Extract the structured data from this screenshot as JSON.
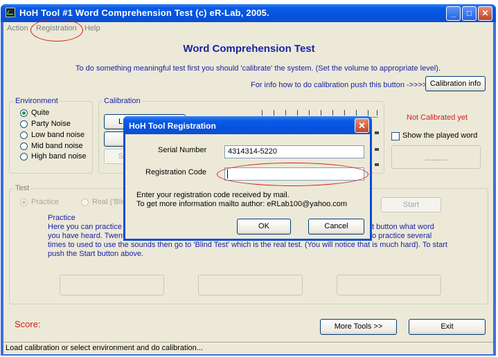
{
  "window": {
    "title": "HoH Tool #1 Word Comprehension Test  (c) eR-Lab, 2005.",
    "minimize": "_",
    "maximize": "□",
    "close": "✕"
  },
  "menu": [
    "Action",
    "Registration",
    "Help"
  ],
  "heading": "Word Comprehension Test",
  "intro": "To do something meaningful test first you should 'calibrate' the system. (Set the volume to appropriate level).",
  "calibration_hint": "For info how to do calibration push this button ->>>>",
  "calibration_info_button": "Calibration info",
  "environment": {
    "label": "Environment",
    "options": [
      "Quite",
      "Party Noise",
      "Low band noise",
      "Mid band noise",
      "High band noise"
    ],
    "selected": 0
  },
  "calibration": {
    "label": "Calibration",
    "button1": "L",
    "button3": "S",
    "status": "Not Calibrated yet",
    "show_word_label": "Show the played word",
    "word_placeholder": ".........."
  },
  "test": {
    "label": "Test",
    "practice_option": "Practice",
    "real_option": "Real ('Blin",
    "start_button": "Start",
    "desc_title": "Practice",
    "desc_line1_left": "Here you can practice",
    "desc_line1_right": "t button what word",
    "desc_line2_left": "you have heard. Twent",
    "desc_line2_right": "o practice several",
    "desc_line3": "times to used to use the sounds then go to 'Blind Test' which is the real test. (You will notice that is much hard).  To start",
    "desc_line4": "push the Start button above."
  },
  "score_label": "Score:",
  "more_tools_button": "More Tools >>",
  "exit_button": "Exit",
  "status_bar": "Load calibration or select environment and do calibration...",
  "dialog": {
    "title": "HoH Tool Registration",
    "close": "✕",
    "serial_label": "Serial Number",
    "serial_value": "4314314-5220",
    "code_label": "Registration Code",
    "code_value": "",
    "info_line1": "Enter your registration code received by mail.",
    "info_line2": "To get more information mailto author: eRLab100@yahoo.com",
    "ok_button": "OK",
    "cancel_button": "Cancel"
  },
  "colors": {
    "title_blue": "#0553de",
    "heading_blue": "#1a22a6",
    "alert_red": "#d21e1e",
    "window_bg": "#ece9d8"
  }
}
